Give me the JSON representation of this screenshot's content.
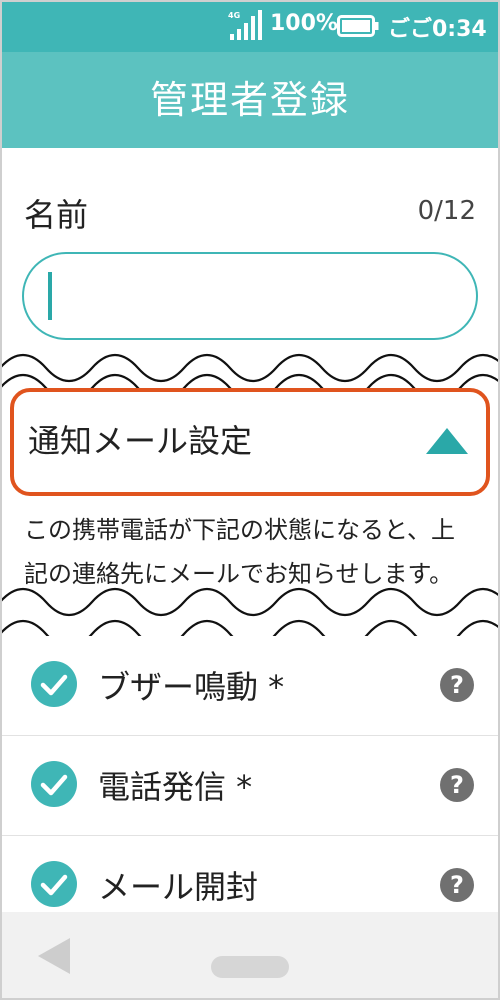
{
  "status_bar": {
    "network_label": "4G",
    "battery_percent": "100%",
    "time": "ごご0:34",
    "icons": [
      "signal-icon",
      "battery-icon"
    ]
  },
  "header": {
    "title": "管理者登録"
  },
  "name_field": {
    "label": "名前",
    "counter": "0/12",
    "value": ""
  },
  "notification": {
    "title": "通知メール設定",
    "expanded": true,
    "description": "この携帯電話が下記の状態になると、上記の連絡先にメールでお知らせします。"
  },
  "options": [
    {
      "label": "ブザー鳴動 *",
      "checked": true
    },
    {
      "label": "電話発信 *",
      "checked": true
    },
    {
      "label": "メール開封",
      "checked": true
    }
  ],
  "colors": {
    "status_bar": "#3fb6b6",
    "header": "#5cc2c0",
    "accent": "#2aa8a8",
    "highlight": "#e0541e",
    "help_icon": "#707070"
  }
}
